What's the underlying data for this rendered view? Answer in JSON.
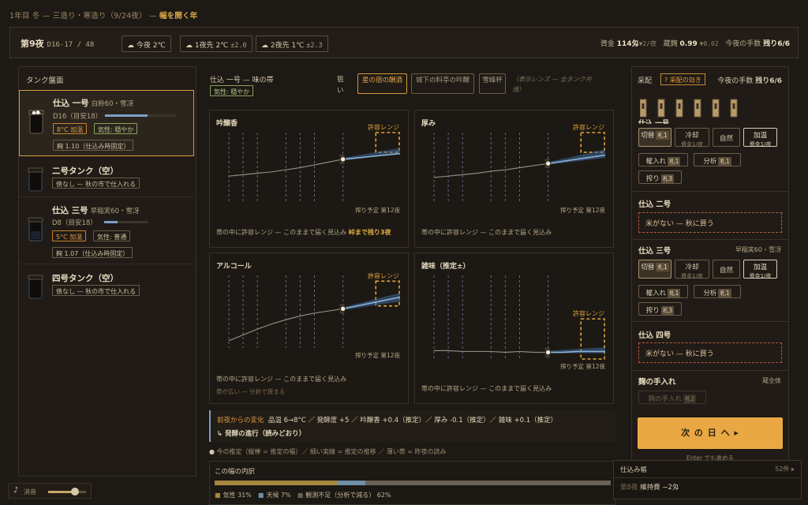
{
  "topline": {
    "season": "1年目 冬 — 三造り・寒造り（9/24夜）",
    "sep": " — ",
    "highlight": "幅を開く年"
  },
  "header": {
    "night": "第9夜",
    "days": "D16-17 / 48",
    "weather": [
      {
        "icon": "cloud-icon",
        "label": "今夜",
        "temp": "2℃",
        "spread": ""
      },
      {
        "icon": "cloud-icon",
        "label": "1夜先",
        "temp": "2℃",
        "spread": "±2.0"
      },
      {
        "icon": "cloud-icon",
        "label": "2夜先",
        "temp": "1℃",
        "spread": "±2.3"
      }
    ],
    "money_label": "資金",
    "money": "114匁",
    "money_delta": "▼2/夜",
    "koji_label": "蔵麹",
    "koji": "0.99",
    "koji_delta": "▼0.02",
    "moves_label": "今夜の手数",
    "moves": "残り6/6"
  },
  "tanks_panel": {
    "title": "タンク盤面"
  },
  "tanks": [
    {
      "name": "仕込 一号",
      "rice": "白粉60・雪冴",
      "day": "D16（目安18）",
      "progress": 0.6,
      "tags": [
        "8°C 加温",
        "気性: 穏やか"
      ],
      "koji": "麹 1.10（仕込み時固定）"
    },
    {
      "name": "二号タンク（空）",
      "note": "债なし — 秋の市で仕入れる"
    },
    {
      "name": "仕込 三号",
      "rice": "早稲実60・雪冴",
      "day": "D8（目安18）",
      "progress": 0.3,
      "tags": [
        "5°C 加温",
        "気性: 普通"
      ],
      "koji": "麹 1.07（仕込み時固定）"
    },
    {
      "name": "四号タンク（空）",
      "note": "债なし — 秋の市で仕入れる"
    }
  ],
  "center": {
    "title": "仕込 一号 — 味の帯",
    "mood": "気性: 穏やか",
    "aim_label": "狙い",
    "aims": [
      "星の宿の酬酒",
      "城下の料亭の吟醸",
      "雪峰杯"
    ],
    "lens_note": "（表示レンズ — 全タンク共通）"
  },
  "charts": [
    {
      "title": "吟醸香",
      "band_label": "許容レンジ",
      "harvest": "搾り予定 第12夜",
      "note": "帯の中に許容レンジ — このままで届く見込み",
      "note_hl": "峠まで残り3夜",
      "sub": "",
      "past": [
        [
          0,
          38
        ],
        [
          1,
          40
        ],
        [
          2,
          42
        ],
        [
          3,
          44
        ],
        [
          4,
          47
        ],
        [
          5,
          50
        ],
        [
          6,
          54
        ],
        [
          7,
          58
        ],
        [
          8,
          62
        ]
      ],
      "future": [
        [
          8,
          62
        ],
        [
          9,
          64
        ],
        [
          10,
          66
        ],
        [
          11,
          68
        ],
        [
          12,
          70
        ]
      ],
      "band_hi": [
        [
          8,
          64
        ],
        [
          12,
          78
        ]
      ],
      "band_lo": [
        [
          8,
          60
        ],
        [
          12,
          70
        ]
      ],
      "range": [
        72,
        100
      ]
    },
    {
      "title": "厚み",
      "band_label": "許容レンジ",
      "harvest": "搾り予定 第12夜",
      "note": "帯の中に許容レンジ — このままで届く見込み",
      "note_hl": "",
      "sub": "",
      "past": [
        [
          0,
          36
        ],
        [
          1,
          38
        ],
        [
          2,
          40
        ],
        [
          3,
          42
        ],
        [
          4,
          45
        ],
        [
          5,
          47
        ],
        [
          6,
          50
        ],
        [
          7,
          53
        ],
        [
          8,
          56
        ]
      ],
      "future": [
        [
          8,
          56
        ],
        [
          9,
          59
        ],
        [
          10,
          62
        ],
        [
          11,
          65
        ],
        [
          12,
          68
        ]
      ],
      "band_hi": [
        [
          8,
          58
        ],
        [
          12,
          76
        ]
      ],
      "band_lo": [
        [
          8,
          54
        ],
        [
          12,
          64
        ]
      ],
      "range": [
        72,
        100
      ]
    },
    {
      "title": "アルコール",
      "band_label": "許容レンジ",
      "harvest": "搾り予定 第12夜",
      "note": "帯の中に許容レンジ — このままで届く見込み",
      "note_hl": "",
      "sub": "帯が広い — 分析で狭まる",
      "past": [
        [
          0,
          10
        ],
        [
          1,
          18
        ],
        [
          2,
          26
        ],
        [
          3,
          33
        ],
        [
          4,
          39
        ],
        [
          5,
          44
        ],
        [
          6,
          48
        ],
        [
          7,
          51
        ],
        [
          8,
          54
        ]
      ],
      "future": [
        [
          8,
          54
        ],
        [
          9,
          58
        ],
        [
          10,
          62
        ],
        [
          11,
          66
        ],
        [
          12,
          70
        ]
      ],
      "band_hi": [
        [
          8,
          56
        ],
        [
          12,
          76
        ]
      ],
      "band_lo": [
        [
          8,
          52
        ],
        [
          12,
          64
        ]
      ],
      "range": [
        58,
        92
      ]
    },
    {
      "title": "雑味（推定±）",
      "band_label": "許容レンジ",
      "harvest": "搾り予定 第12夜",
      "note": "帯の中に許容レンジ — このままで届く見込み",
      "note_hl": "",
      "sub": "",
      "past": [
        [
          0,
          10
        ],
        [
          1,
          10
        ],
        [
          2,
          9
        ],
        [
          3,
          9
        ],
        [
          4,
          9
        ],
        [
          5,
          8
        ],
        [
          6,
          9
        ],
        [
          7,
          8
        ],
        [
          8,
          8
        ]
      ],
      "future": [
        [
          8,
          8
        ],
        [
          9,
          8
        ],
        [
          10,
          9
        ],
        [
          11,
          9
        ],
        [
          12,
          9
        ]
      ],
      "band_hi": [
        [
          8,
          10
        ],
        [
          12,
          14
        ]
      ],
      "band_lo": [
        [
          8,
          7
        ],
        [
          12,
          7
        ]
      ],
      "range": [
        0,
        48
      ]
    }
  ],
  "change": {
    "label": "前夜からの変化",
    "text": "品温 6→8°C ／ 発酵度 +5 ／ 吟醸香 +0.4（推定）／ 厚み -0.1（推定）／ 雑味 +0.1（推定）",
    "progress": "↳ 発酵の進行（読みどおり）"
  },
  "legend_line": "今の推定（縦棒 = 推定の幅）／ 細い実線 = 推定の推移 ／ 薄い帯 = 昨夜の読み",
  "breakdown": {
    "title": "この幅の内訳",
    "parts": [
      {
        "label": "気性",
        "pct": 31,
        "color": "#a6853f"
      },
      {
        "label": "天候",
        "pct": 7,
        "color": "#6f8fa8"
      },
      {
        "label": "観測不足（分析で減る）",
        "pct": 62,
        "color": "#6a6255"
      }
    ]
  },
  "volume": {
    "label": "消音",
    "level": 0.7
  },
  "right": {
    "title": "采配",
    "help": "采配の効き",
    "moves_label": "今夜の手数",
    "moves": "残り6/6",
    "t1": {
      "name": "仕込 一号"
    },
    "temp_buttons": [
      {
        "label": "切替",
        "token": "札1"
      },
      {
        "label": "冷却",
        "sub": "資金1/夜"
      },
      {
        "label": "自然"
      },
      {
        "label": "加温",
        "sub": "資金1/夜"
      }
    ],
    "actions": [
      {
        "label": "櫂入れ",
        "token": "札1"
      },
      {
        "label": "分析",
        "token": "札1"
      },
      {
        "label": "搾り",
        "token": "札3"
      }
    ],
    "t2": {
      "name": "仕込 二号",
      "warn": "米がない — 秋に買う"
    },
    "t3": {
      "name": "仕込 三号",
      "rice": "早稲実60・雪冴"
    },
    "t3_temp": [
      {
        "label": "切替",
        "token": "札1"
      },
      {
        "label": "冷却",
        "sub": "資金1/夜"
      },
      {
        "label": "自然"
      },
      {
        "label": "加温",
        "sub": "資金1/夜"
      }
    ],
    "t3_actions": [
      {
        "label": "櫂入れ",
        "token": "札1"
      },
      {
        "label": "分析",
        "token": "札1"
      },
      {
        "label": "搾り",
        "token": "札3"
      }
    ],
    "t4": {
      "name": "仕込 四号",
      "warn": "米がない — 秋に買う"
    },
    "koji": {
      "title": "麹の手入れ",
      "scope": "蔵全体",
      "button": "麹の手入れ",
      "token": "札2"
    },
    "next": {
      "label": "次 の 日 へ ▸",
      "hint": "Enter でも進める"
    }
  },
  "log": {
    "title": "仕込み帳",
    "count": "52件",
    "entry_day": "第8夜",
    "entry": "維持費 −2匁"
  }
}
